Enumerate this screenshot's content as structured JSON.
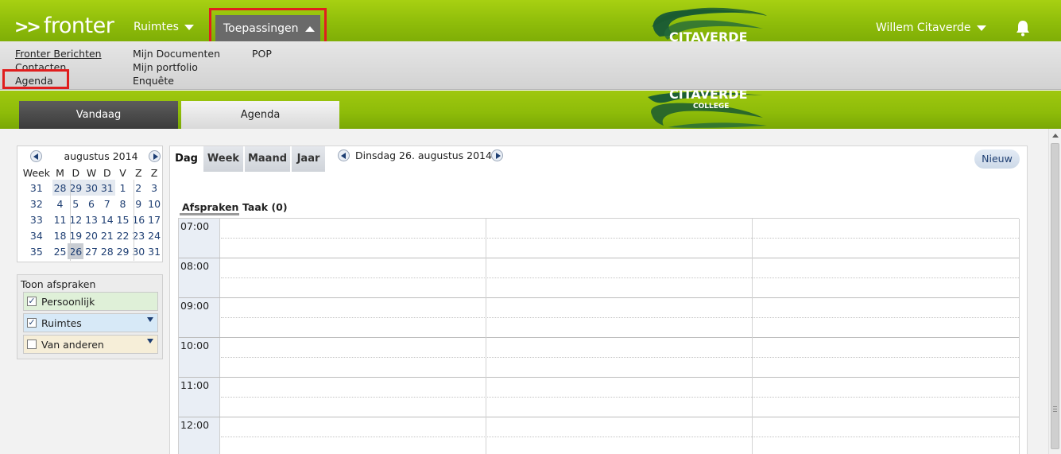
{
  "header": {
    "logo_text": "fronter",
    "logo_prefix": ">>",
    "nav_ruimtes": "Ruimtes",
    "nav_toepassingen": "Toepassingen",
    "user_name": "Willem Citaverde"
  },
  "dropdown": {
    "col1": [
      "Fronter Berichten",
      "Contacten",
      "Agenda"
    ],
    "col2": [
      "Mijn Documenten",
      "Mijn portfolio",
      "Enquête"
    ],
    "col3": [
      "POP"
    ]
  },
  "brand": {
    "line1": "CITAVERDE",
    "line2": "COLLEGE"
  },
  "tabs": {
    "vandaag": "Vandaag",
    "agenda": "Agenda"
  },
  "minical": {
    "title": "augustus 2014",
    "week_label": "Week",
    "day_headers": [
      "M",
      "D",
      "W",
      "D",
      "V",
      "Z",
      "Z"
    ],
    "weeks": [
      {
        "week": "31",
        "days": [
          "28",
          "29",
          "30",
          "31",
          "1",
          "2",
          "3"
        ]
      },
      {
        "week": "32",
        "days": [
          "4",
          "5",
          "6",
          "7",
          "8",
          "9",
          "10"
        ]
      },
      {
        "week": "33",
        "days": [
          "11",
          "12",
          "13",
          "14",
          "15",
          "16",
          "17"
        ]
      },
      {
        "week": "34",
        "days": [
          "18",
          "19",
          "20",
          "21",
          "22",
          "23",
          "24"
        ]
      },
      {
        "week": "35",
        "days": [
          "25",
          "26",
          "27",
          "28",
          "29",
          "30",
          "31"
        ]
      }
    ],
    "selected_day": "26"
  },
  "toon": {
    "title": "Toon afspraken",
    "items": [
      {
        "label": "Persoonlijk",
        "checked": true,
        "color": "#dff0d8"
      },
      {
        "label": "Ruimtes",
        "checked": true,
        "color": "#d7e9f7"
      },
      {
        "label": "Van anderen",
        "checked": false,
        "color": "#f6eed8"
      }
    ]
  },
  "view_tabs": [
    "Dag",
    "Week",
    "Maand",
    "Jaar"
  ],
  "active_view": "Dag",
  "current_date": "Dinsdag 26. augustus 2014",
  "new_button": "Nieuw",
  "subtabs": {
    "afspraken": "Afspraken",
    "taak": "Taak (0)"
  },
  "hours": [
    "07:00",
    "08:00",
    "09:00",
    "10:00",
    "11:00",
    "12:00"
  ],
  "colors": {
    "green_band": "#8fbd0a",
    "highlight_red": "#e01e1e",
    "link_blue": "#1f3f73"
  }
}
